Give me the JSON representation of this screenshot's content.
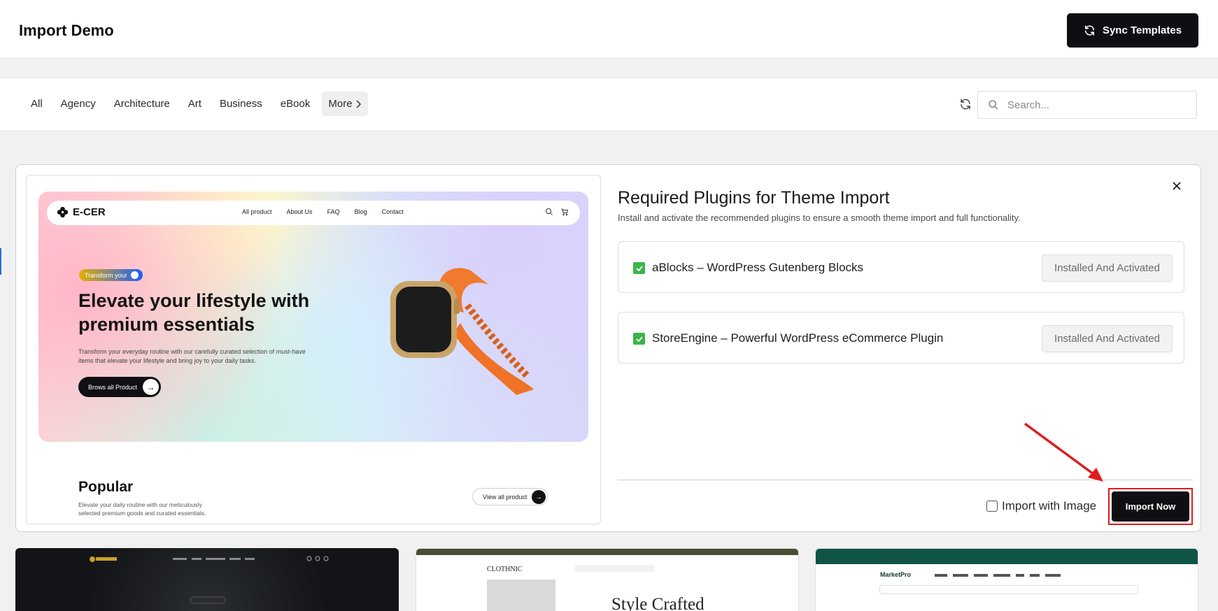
{
  "header": {
    "title": "Import Demo",
    "sync_label": "Sync Templates"
  },
  "filters": {
    "categories": [
      "All",
      "Agency",
      "Architecture",
      "Art",
      "Business",
      "eBook"
    ],
    "more_label": "More",
    "search_placeholder": "Search..."
  },
  "modal": {
    "title": "Required Plugins for Theme Import",
    "subtitle": "Install and activate the recommended plugins to ensure a smooth theme import and full functionality.",
    "plugins": [
      {
        "name": "aBlocks – WordPress Gutenberg Blocks",
        "status": "Installed And Activated",
        "checked": true
      },
      {
        "name": "StoreEngine – Powerful WordPress eCommerce Plugin",
        "status": "Installed And Activated",
        "checked": true
      }
    ],
    "import_with_image_label": "Import with Image",
    "import_with_image_checked": false,
    "import_now_label": "Import Now",
    "highlight_color": "#e01d1d"
  },
  "preview": {
    "logo": "E-CER",
    "nav_links": [
      "All product",
      "About Us",
      "FAQ",
      "Blog",
      "Contact"
    ],
    "badge": "Transform your",
    "headline": "Elevate your lifestyle with premium essentials",
    "description": "Transform your everyday routine with our carefully curated selection of must-have items that elevate your lifestyle and bring joy to your daily tasks.",
    "cta": "Brows all Product",
    "popular_title": "Popular",
    "popular_desc": "Elevate your daily routine with our meticulously selected premium goods and curated essentials.",
    "view_all": "View all product"
  },
  "cards": {
    "card2_logo": "CLOTHNIC",
    "card2_heading": "Style Crafted",
    "card3_logo": "MarketPro"
  },
  "colors": {
    "primary_dark": "#0f0f13",
    "check_green": "#3cb44b"
  }
}
